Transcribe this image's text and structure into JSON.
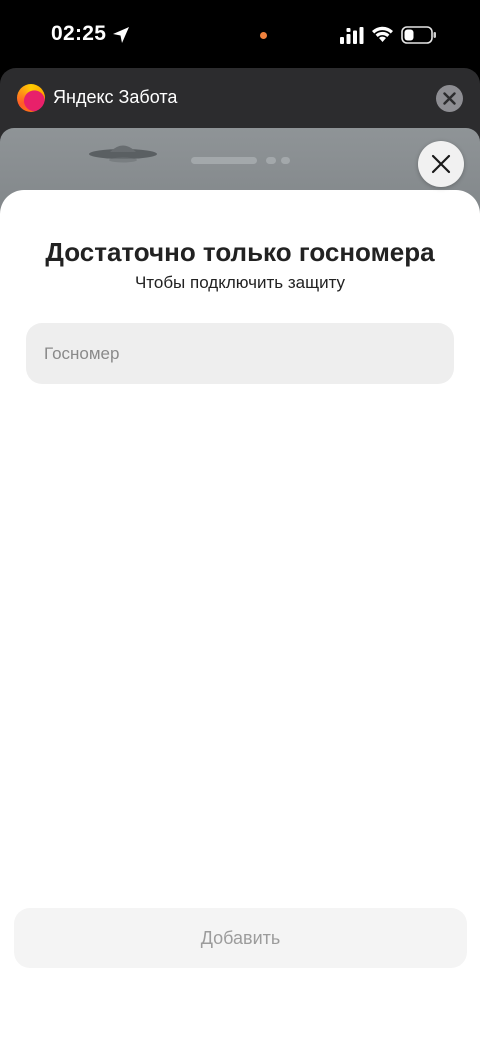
{
  "status_bar": {
    "time": "02:25",
    "icons": [
      "location-arrow-icon",
      "cellular-signal-icon",
      "wifi-icon",
      "battery-icon"
    ]
  },
  "app": {
    "title": "Яндекс Забота",
    "logo_icon": "yandex-zabota-logo-icon",
    "close_icon": "close-icon"
  },
  "banner": {
    "image_icon": "ufo-icon"
  },
  "modal": {
    "close_icon": "close-icon",
    "title": "Достаточно только госномера",
    "subtitle": "Чтобы подключить защиту",
    "plate_field": {
      "placeholder": "Госномер",
      "value": ""
    },
    "add_button_label": "Добавить"
  },
  "colors": {
    "sheet_background": "#ffffff",
    "field_background": "#eeeeee",
    "button_background": "#f4f4f4",
    "button_text_disabled": "#9c9c9c",
    "app_header_background": "#2c2c2e"
  }
}
